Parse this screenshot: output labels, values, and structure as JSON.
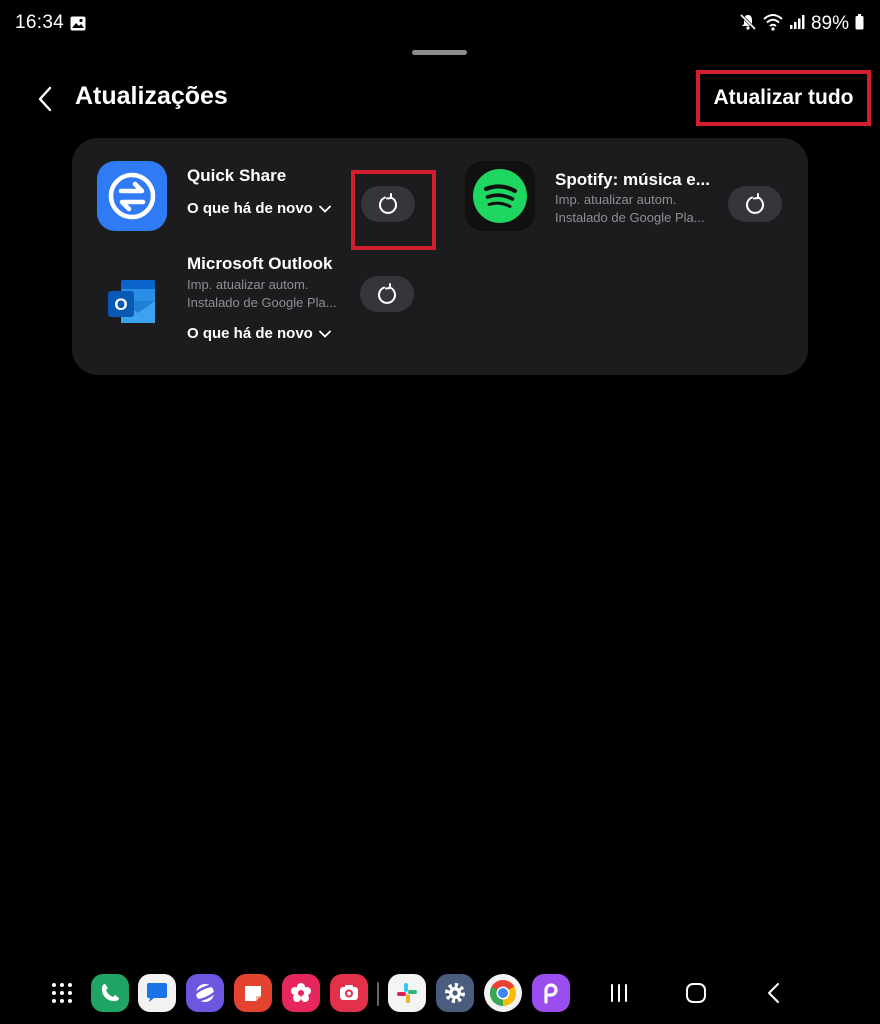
{
  "status_bar": {
    "time": "16:34",
    "battery": "89%",
    "icons": [
      "gallery-icon",
      "mute-icon",
      "wifi-icon",
      "signal-icon",
      "battery-icon"
    ]
  },
  "header": {
    "title": "Atualizações",
    "update_all_label": "Atualizar tudo"
  },
  "apps": [
    {
      "name": "Quick Share",
      "whats_new": "O que há de novo",
      "icon": "quick-share-icon"
    },
    {
      "name": "Spotify: música e...",
      "line1": "Imp. atualizar autom.",
      "line2": "Instalado de Google Pla...",
      "icon": "spotify-icon"
    },
    {
      "name": "Microsoft Outlook",
      "line1": "Imp. atualizar autom.",
      "line2": "Instalado de Google Pla...",
      "whats_new": "O que há de novo",
      "icon": "outlook-icon"
    }
  ],
  "colors": {
    "background": "#000000",
    "card": "#1c1c1e",
    "highlight": "#d11f2d",
    "button": "#36363a",
    "subtext": "#8e8e93"
  },
  "dock": {
    "apps": [
      "phone-icon",
      "messages-icon",
      "internet-icon",
      "notes-icon",
      "gallery-flower-icon",
      "camera-icon",
      "slack-icon",
      "settings-icon",
      "chrome-icon",
      "picsart-icon"
    ],
    "nav": [
      "recents-nav-icon",
      "home-nav-icon",
      "back-nav-icon"
    ]
  }
}
